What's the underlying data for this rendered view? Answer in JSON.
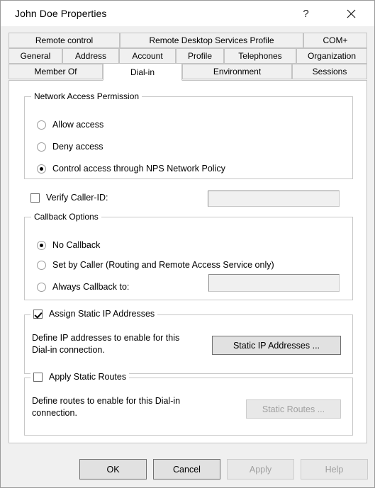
{
  "window": {
    "title": "John Doe Properties",
    "help_icon": "question-mark-icon",
    "help_glyph": "?",
    "close_icon": "close-icon"
  },
  "tabs": {
    "row1": [
      {
        "label": "Remote control",
        "active": false
      },
      {
        "label": "Remote Desktop Services Profile",
        "active": false
      },
      {
        "label": "COM+",
        "active": false
      }
    ],
    "row2": [
      {
        "label": "General",
        "active": false
      },
      {
        "label": "Address",
        "active": false
      },
      {
        "label": "Account",
        "active": false
      },
      {
        "label": "Profile",
        "active": false
      },
      {
        "label": "Telephones",
        "active": false
      },
      {
        "label": "Organization",
        "active": false
      }
    ],
    "row3": [
      {
        "label": "Member Of",
        "active": false
      },
      {
        "label": "Dial-in",
        "active": true
      },
      {
        "label": "Environment",
        "active": false
      },
      {
        "label": "Sessions",
        "active": false
      }
    ]
  },
  "network_access_permission": {
    "title": "Network Access Permission",
    "options": [
      {
        "label": "Allow access",
        "selected": false
      },
      {
        "label": "Deny access",
        "selected": false
      },
      {
        "label": "Control access through NPS Network Policy",
        "selected": true
      }
    ]
  },
  "verify_caller_id": {
    "label": "Verify Caller-ID:",
    "checked": false,
    "value": "",
    "enabled": false
  },
  "callback_options": {
    "title": "Callback Options",
    "options": [
      {
        "label": "No Callback",
        "selected": true
      },
      {
        "label": "Set by Caller (Routing and Remote Access Service only)",
        "selected": false
      },
      {
        "label": "Always Callback to:",
        "selected": false
      }
    ],
    "callback_value": "",
    "callback_enabled": false
  },
  "static_ip": {
    "title": "Assign Static IP Addresses",
    "checked": true,
    "description": "Define IP addresses to enable for this\nDial-in connection.",
    "button_label": "Static IP Addresses ...",
    "button_enabled": true
  },
  "static_routes": {
    "title": "Apply Static Routes",
    "checked": false,
    "description": "Define routes to enable for this Dial-in\nconnection.",
    "button_label": "Static Routes ...",
    "button_enabled": false
  },
  "footer": {
    "ok": {
      "label": "OK",
      "enabled": true
    },
    "cancel": {
      "label": "Cancel",
      "enabled": true
    },
    "apply": {
      "label": "Apply",
      "enabled": false
    },
    "help": {
      "label": "Help",
      "enabled": false
    }
  },
  "colors": {
    "dialog_bg": "#f0f0f0",
    "panel_bg": "#ffffff",
    "titlebar_bg": "#ffffff",
    "tab_border": "#c3c3c3",
    "group_border": "#c8c8c8",
    "button_bg": "#e1e1e1",
    "disabled_text": "#a0a0a0"
  }
}
